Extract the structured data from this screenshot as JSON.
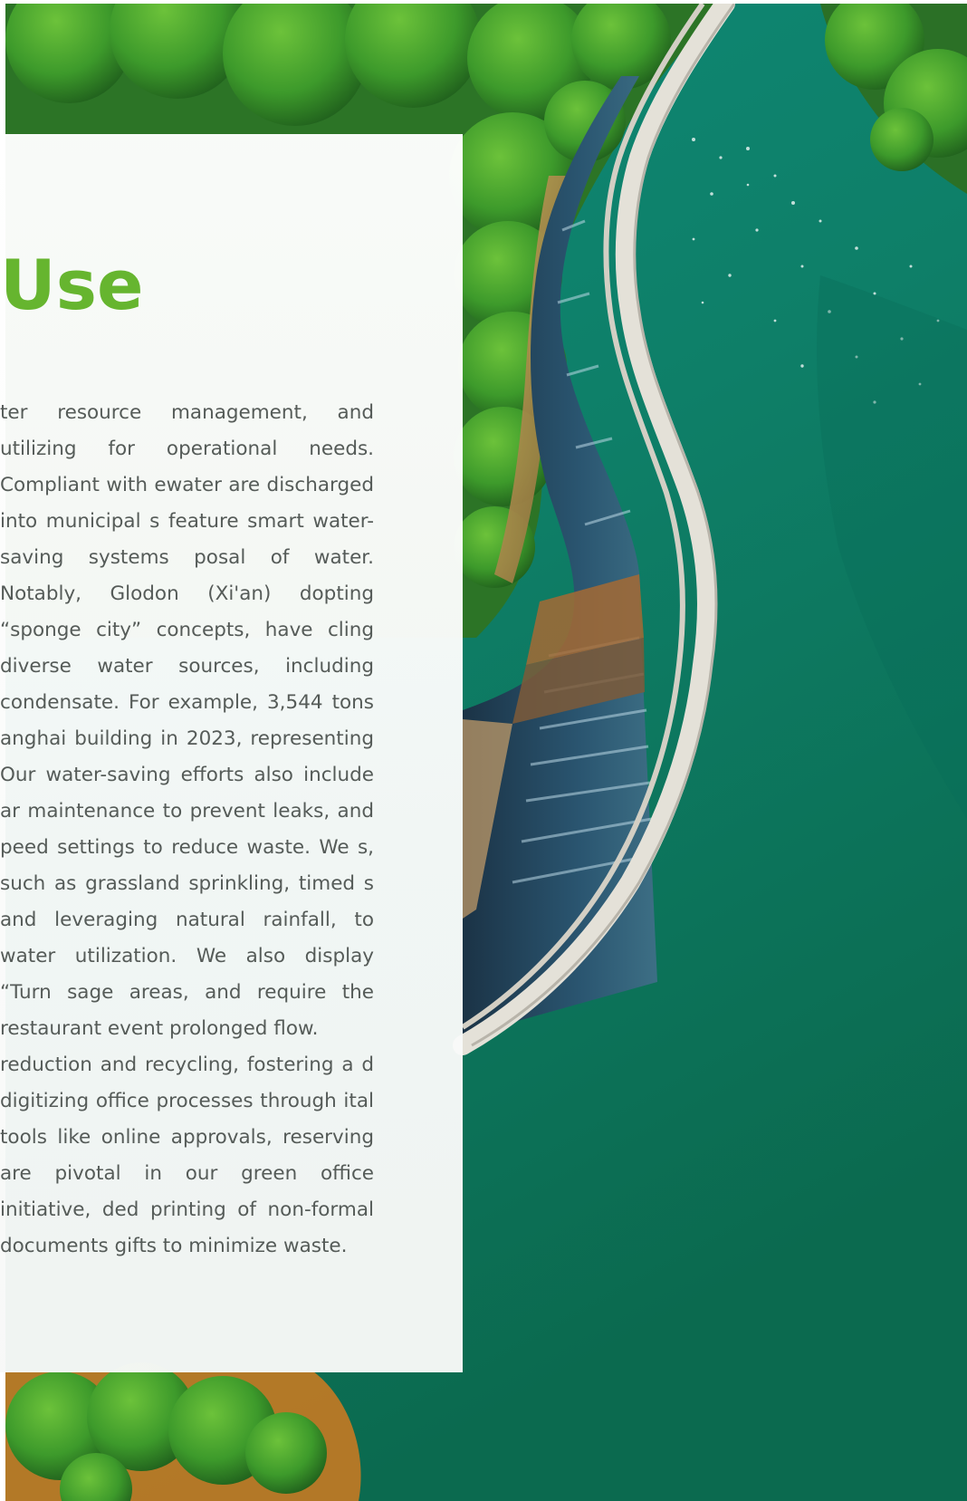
{
  "section": {
    "title": "Use"
  },
  "paragraphs": [
    "ter resource management, and utilizing for operational needs. Compliant with ewater are discharged into municipal s feature smart water-saving systems posal of water. Notably, Glodon (Xi'an) dopting “sponge city” concepts, have cling diverse water sources, including condensate. For example, 3,544 tons anghai building in 2023, representing Our water-saving efforts also include ar maintenance to prevent leaks, and peed settings to reduce waste. We s, such as grassland sprinkling, timed s and leveraging natural rainfall, to water utilization. We also display “Turn sage areas, and require the restaurant event prolonged flow.",
    "reduction and recycling, fostering a d digitizing office processes through ital tools like online approvals, reserving are pivotal in our green office initiative, ded printing of non-formal documents gifts to minimize waste."
  ],
  "photo": {
    "subject": "aerial view of a curved reservoir dam between forest and green water",
    "colors": {
      "water": "#0e7f68",
      "forest": "#2f7d2a",
      "dam_wall": "#d9d7cf",
      "spillway": "#24455a"
    }
  },
  "colors": {
    "accent": "#66b52f",
    "body_text": "#555b58",
    "panel": "#f8f9f8"
  }
}
